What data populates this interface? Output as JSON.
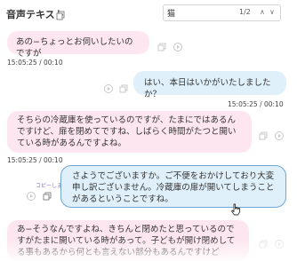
{
  "header": {
    "title": "音声テキスト",
    "search_value": "猫",
    "match_count": "1/2"
  },
  "messages": [
    {
      "side": "left",
      "text": "あの−ちょっとお伺いしたいのですが",
      "time": "15:05:25 / 00:10"
    },
    {
      "side": "right",
      "text": "はい、本日はいかがいたしましたか？",
      "time": "15:05:25 / 00:10"
    },
    {
      "side": "left",
      "text": "そちらの冷蔵庫を使っているのですが、たまにではあるんですけど、扉を閉めてですね、しばらく時間がたつと開いている時があるんですよね。",
      "time": "15:05:25 / 00:10"
    },
    {
      "side": "right",
      "text": "さようでございますか。ご不便をおかけしており大変申し訳ございません。冷蔵庫の扉が開いてしまうことがあるということですね。",
      "time": ""
    },
    {
      "side": "left",
      "text": "あ−そうなんですよね、きちんと閉めたと思っているのですがたまに開いている時があって。子どもが開け閉めしてる事もあるから何とも言えない部分もあるんですけど",
      "time": ""
    }
  ],
  "copy_hint": "コピーしました",
  "icons": [
    "copy-icon",
    "play-icon",
    "search-up-icon",
    "search-down-icon",
    "cursor-icon"
  ]
}
